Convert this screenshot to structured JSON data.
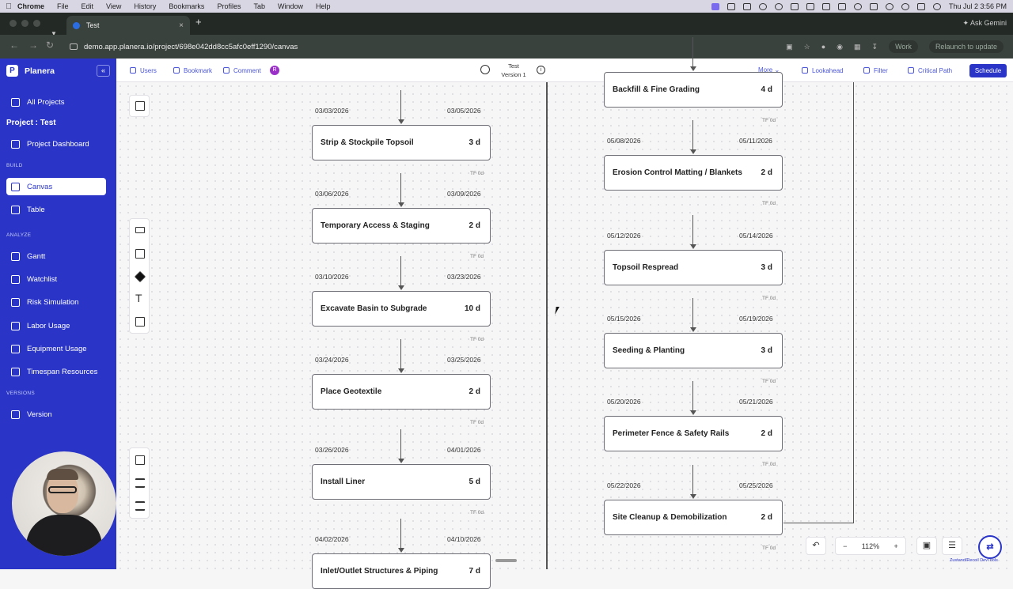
{
  "menubar": {
    "app": "Chrome",
    "items": [
      "File",
      "Edit",
      "View",
      "History",
      "Bookmarks",
      "Profiles",
      "Tab",
      "Window",
      "Help"
    ],
    "clock": "Thu Jul 2  3:56 PM"
  },
  "browser": {
    "tab_title": "Test",
    "url": "demo.app.planera.io/project/698e042dd8cc5afc0eff1290/canvas",
    "ask_gemini": "Ask Gemini",
    "work": "Work",
    "relaunch": "Relaunch to update"
  },
  "sidebar": {
    "brand": "Planera",
    "all_projects": "All Projects",
    "project_label": "Project : Test",
    "project_dashboard": "Project Dashboard",
    "section_build": "BUILD",
    "canvas": "Canvas",
    "table": "Table",
    "section_analyze": "ANALYZE",
    "gantt": "Gantt",
    "watchlist": "Watchlist",
    "risk_simulation": "Risk Simulation",
    "labor_usage": "Labor Usage",
    "equipment_usage": "Equipment Usage",
    "timespan_resources": "Timespan Resources",
    "section_versions": "VERSIONS",
    "version": "Version"
  },
  "toolbar": {
    "users": "Users",
    "bookmark": "Bookmark",
    "comment": "Comment",
    "avatar_initial": "R",
    "title": "Test",
    "version": "Version 1",
    "more": "More",
    "lookahead": "Lookahead",
    "filter": "Filter",
    "critical_path": "Critical Path",
    "schedule": "Schedule"
  },
  "left_column": [
    {
      "name": "Strip & Stockpile Topsoil",
      "duration": "3 d",
      "start": "03/03/2026",
      "end": "03/05/2026",
      "tf": "TF 0d"
    },
    {
      "name": "Temporary Access & Staging",
      "duration": "2 d",
      "start": "03/06/2026",
      "end": "03/09/2026",
      "tf": "TF 0d"
    },
    {
      "name": "Excavate Basin to Subgrade",
      "duration": "10 d",
      "start": "03/10/2026",
      "end": "03/23/2026",
      "tf": "TF 0d"
    },
    {
      "name": "Place Geotextile",
      "duration": "2 d",
      "start": "03/24/2026",
      "end": "03/25/2026",
      "tf": "TF 0d"
    },
    {
      "name": "Install Liner",
      "duration": "5 d",
      "start": "03/26/2026",
      "end": "04/01/2026",
      "tf": "TF 0d"
    },
    {
      "name": "Inlet/Outlet Structures & Piping",
      "duration": "7 d",
      "start": "04/02/2026",
      "end": "04/10/2026",
      "tf": ""
    }
  ],
  "right_column": [
    {
      "name": "Backfill & Fine Grading",
      "duration": "4 d",
      "start": "",
      "end": "",
      "tf": "TF 0d"
    },
    {
      "name": "Erosion Control Matting / Blankets",
      "duration": "2 d",
      "start": "05/08/2026",
      "end": "05/11/2026",
      "tf": "TF 0d"
    },
    {
      "name": "Topsoil Respread",
      "duration": "3 d",
      "start": "05/12/2026",
      "end": "05/14/2026",
      "tf": "TF 0d"
    },
    {
      "name": "Seeding & Planting",
      "duration": "3 d",
      "start": "05/15/2026",
      "end": "05/19/2026",
      "tf": "TF 0d"
    },
    {
      "name": "Perimeter Fence & Safety Rails",
      "duration": "2 d",
      "start": "05/20/2026",
      "end": "05/21/2026",
      "tf": "TF 0d"
    },
    {
      "name": "Site Cleanup & Demobilization",
      "duration": "2 d",
      "start": "05/22/2026",
      "end": "05/25/2026",
      "tf": "TF 0d"
    }
  ],
  "zoom": {
    "level": "112%"
  },
  "devtools_label": "Zustand/Recoil DevTools"
}
